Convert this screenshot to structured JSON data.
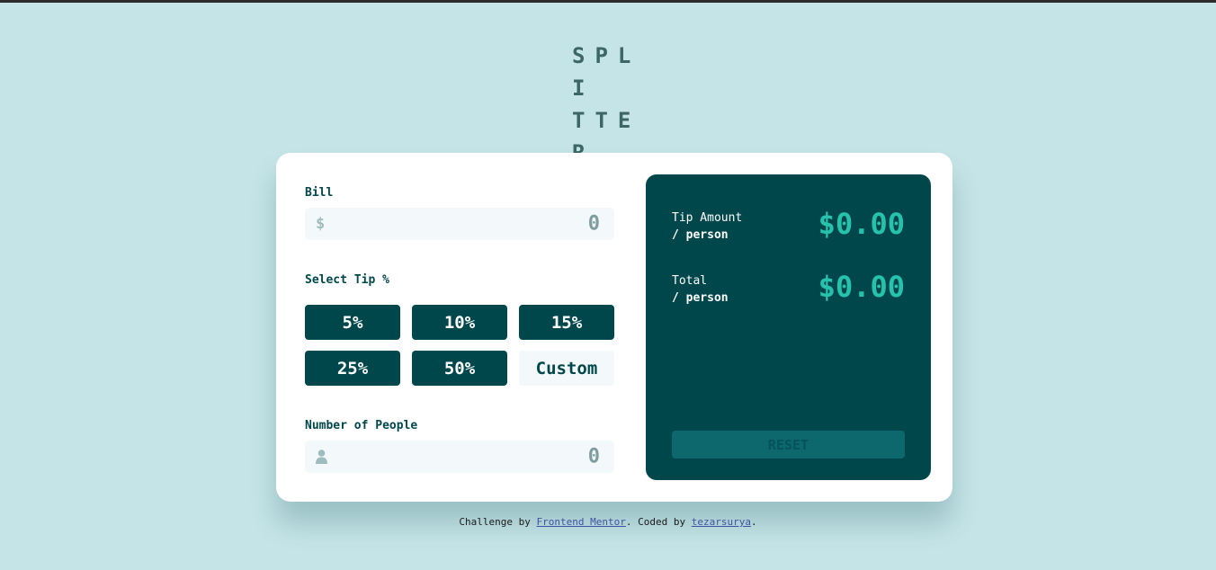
{
  "logo": {
    "line1": "SPLI",
    "line2": "TTER"
  },
  "bill": {
    "label": "Bill",
    "currency_symbol": "$",
    "value": "0"
  },
  "tip": {
    "label": "Select Tip %",
    "options": [
      "5%",
      "10%",
      "15%",
      "25%",
      "50%"
    ],
    "custom_label": "Custom"
  },
  "people": {
    "label": "Number of People",
    "icon": "person-icon",
    "value": "0"
  },
  "results": {
    "tip_amount": {
      "label": "Tip Amount",
      "sub": "/ person",
      "value": "$0.00"
    },
    "total": {
      "label": "Total",
      "sub": "/ person",
      "value": "$0.00"
    },
    "reset_label": "RESET"
  },
  "footer": {
    "prefix": "Challenge by ",
    "link1": "Frontend Mentor",
    "middle": ". Coded by ",
    "link2": "tezarsurya",
    "suffix": "."
  },
  "colors": {
    "background": "#c5e4e7",
    "dark_cyan": "#00474b",
    "accent_cyan": "#26c2ae",
    "input_bg": "#f3f9fa"
  }
}
